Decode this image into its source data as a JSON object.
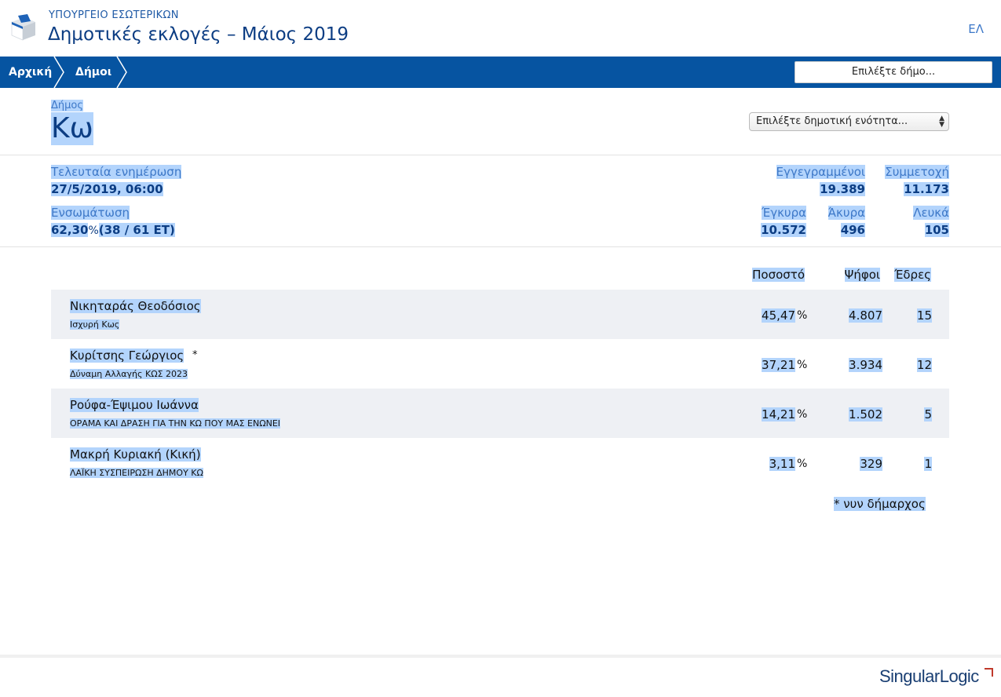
{
  "header": {
    "ministry": "ΥΠΟΥΡΓΕΙΟ ΕΣΩΤΕΡΙΚΩΝ",
    "title": "Δημοτικές εκλογές – Μάιος 2019",
    "language": "ΕΛ",
    "logo_icon": "ballot-box-icon"
  },
  "nav": {
    "breadcrumbs": [
      "Αρχική",
      "Δήμοι"
    ],
    "search_placeholder": "Επιλέξτε δήμο..."
  },
  "municipality": {
    "label": "Δήμος",
    "name": "Κω",
    "unit_select": "Επιλέξτε δημοτική ενότητα..."
  },
  "stats": {
    "last_update_label": "Τελευταία ενημέρωση",
    "last_update_value": "27/5/2019, 06:00",
    "integration_label": "Ενσωμάτωση",
    "integration_pct": "62,30",
    "integration_pct_sign": "%",
    "integration_detail": "(38 / 61 ΕΤ)",
    "registered_label": "Εγγεγραμμένοι",
    "registered_value": "19.389",
    "turnout_label": "Συμμετοχή",
    "turnout_value": "11.173",
    "valid_label": "Έγκυρα",
    "valid_value": "10.572",
    "invalid_label": "Άκυρα",
    "invalid_value": "496",
    "blank_label": "Λευκά",
    "blank_value": "105"
  },
  "results": {
    "headers": {
      "percent": "Ποσοστό",
      "votes": "Ψήφοι",
      "seats": "Έδρες"
    },
    "percent_sign": "%",
    "rows": [
      {
        "candidate": "Νικηταράς Θεοδόσιος",
        "party": "Ισχυρή Κως",
        "percent": "45,47",
        "votes": "4.807",
        "seats": "15",
        "incumbent": ""
      },
      {
        "candidate": "Κυρίτσης Γεώργιος",
        "party": "Δύναμη Αλλαγής ΚΩΣ 2023",
        "percent": "37,21",
        "votes": "3.934",
        "seats": "12",
        "incumbent": "*"
      },
      {
        "candidate": "Ρούφα-Έψιμου Ιωάννα",
        "party": "ΟΡΑΜΑ ΚΑΙ ΔΡΑΣΗ ΓΙΑ ΤΗΝ ΚΩ ΠΟΥ ΜΑΣ ΕΝΩΝΕΙ",
        "percent": "14,21",
        "votes": "1.502",
        "seats": "5",
        "incumbent": ""
      },
      {
        "candidate": "Μακρή Κυριακή (Κική)",
        "party": "ΛΑΪΚΗ ΣΥΣΠΕΙΡΩΣΗ ΔΗΜΟΥ ΚΩ",
        "percent": "3,11",
        "votes": "329",
        "seats": "1",
        "incumbent": ""
      }
    ],
    "footnote": "* νυν δήμαρχος"
  },
  "footer": {
    "brand": "SingularLogic"
  },
  "colors": {
    "nav_bg": "#0654a1",
    "title": "#0c3d83",
    "label": "#3d78c8",
    "selection": "#b3d4fc",
    "brand_accent": "#c0392b"
  }
}
